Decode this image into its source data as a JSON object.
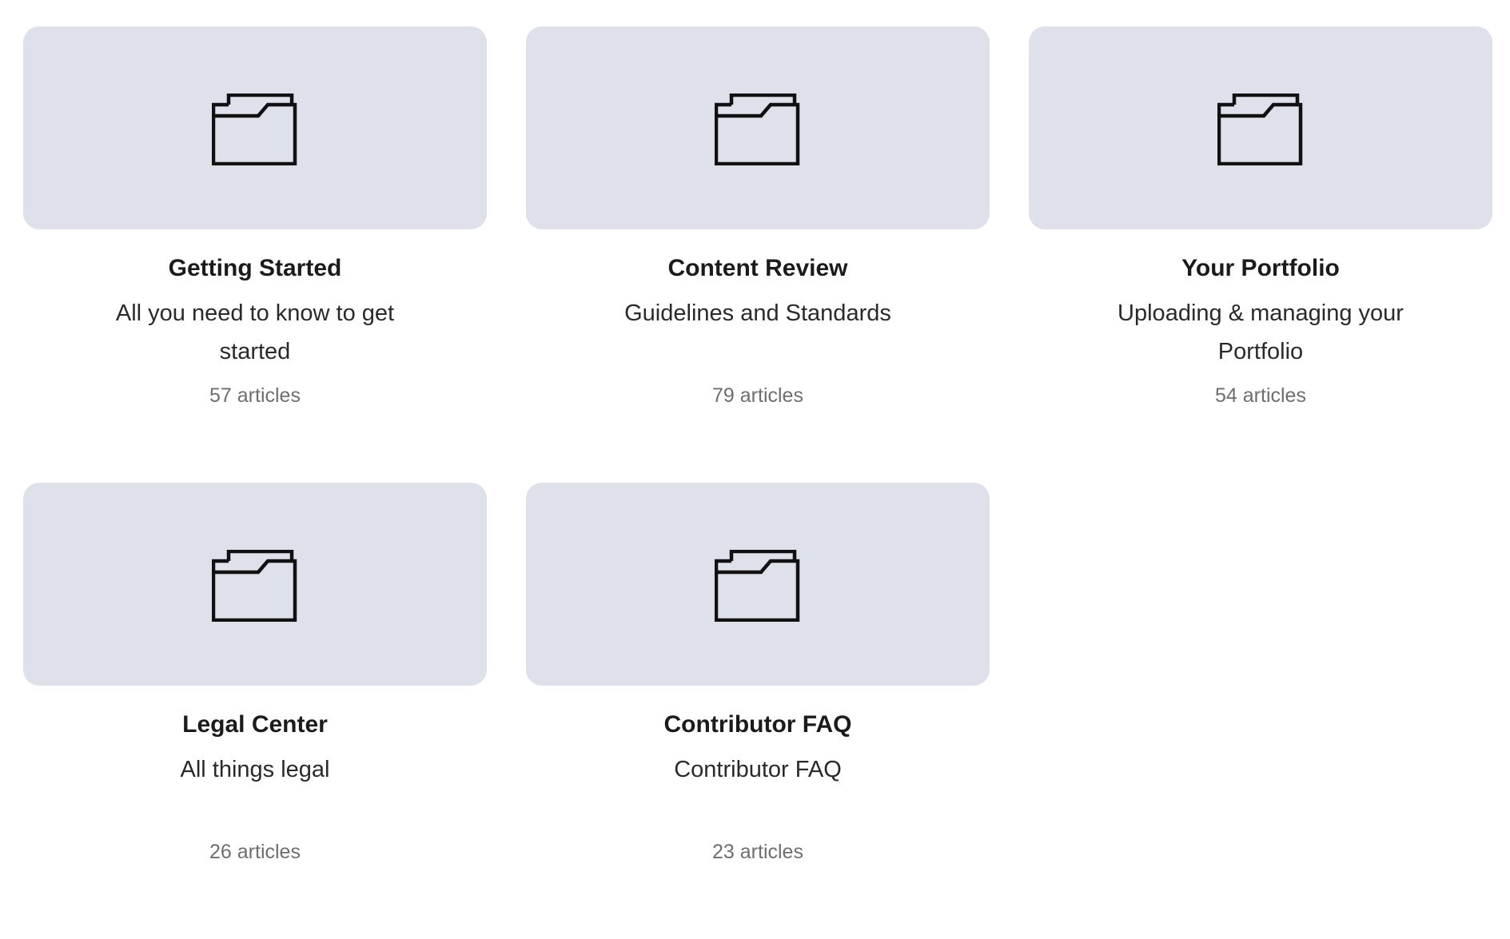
{
  "categories": [
    {
      "title": "Getting Started",
      "description": "All you need to know to get started",
      "count": "57 articles",
      "icon": "folder-icon"
    },
    {
      "title": "Content Review",
      "description": "Guidelines and Standards",
      "count": "79 articles",
      "icon": "folder-icon"
    },
    {
      "title": "Your Portfolio",
      "description": "Uploading & managing your Portfolio",
      "count": "54 articles",
      "icon": "folder-icon"
    },
    {
      "title": "Legal Center",
      "description": "All things legal",
      "count": "26 articles",
      "icon": "folder-icon"
    },
    {
      "title": "Contributor FAQ",
      "description": "Contributor FAQ",
      "count": "23 articles",
      "icon": "folder-icon"
    }
  ],
  "colors": {
    "card_background": "#dfe1ea",
    "title": "#1b1b1b",
    "description": "#2a2a2a",
    "count": "#6e6e6e",
    "icon_stroke": "#111111"
  }
}
